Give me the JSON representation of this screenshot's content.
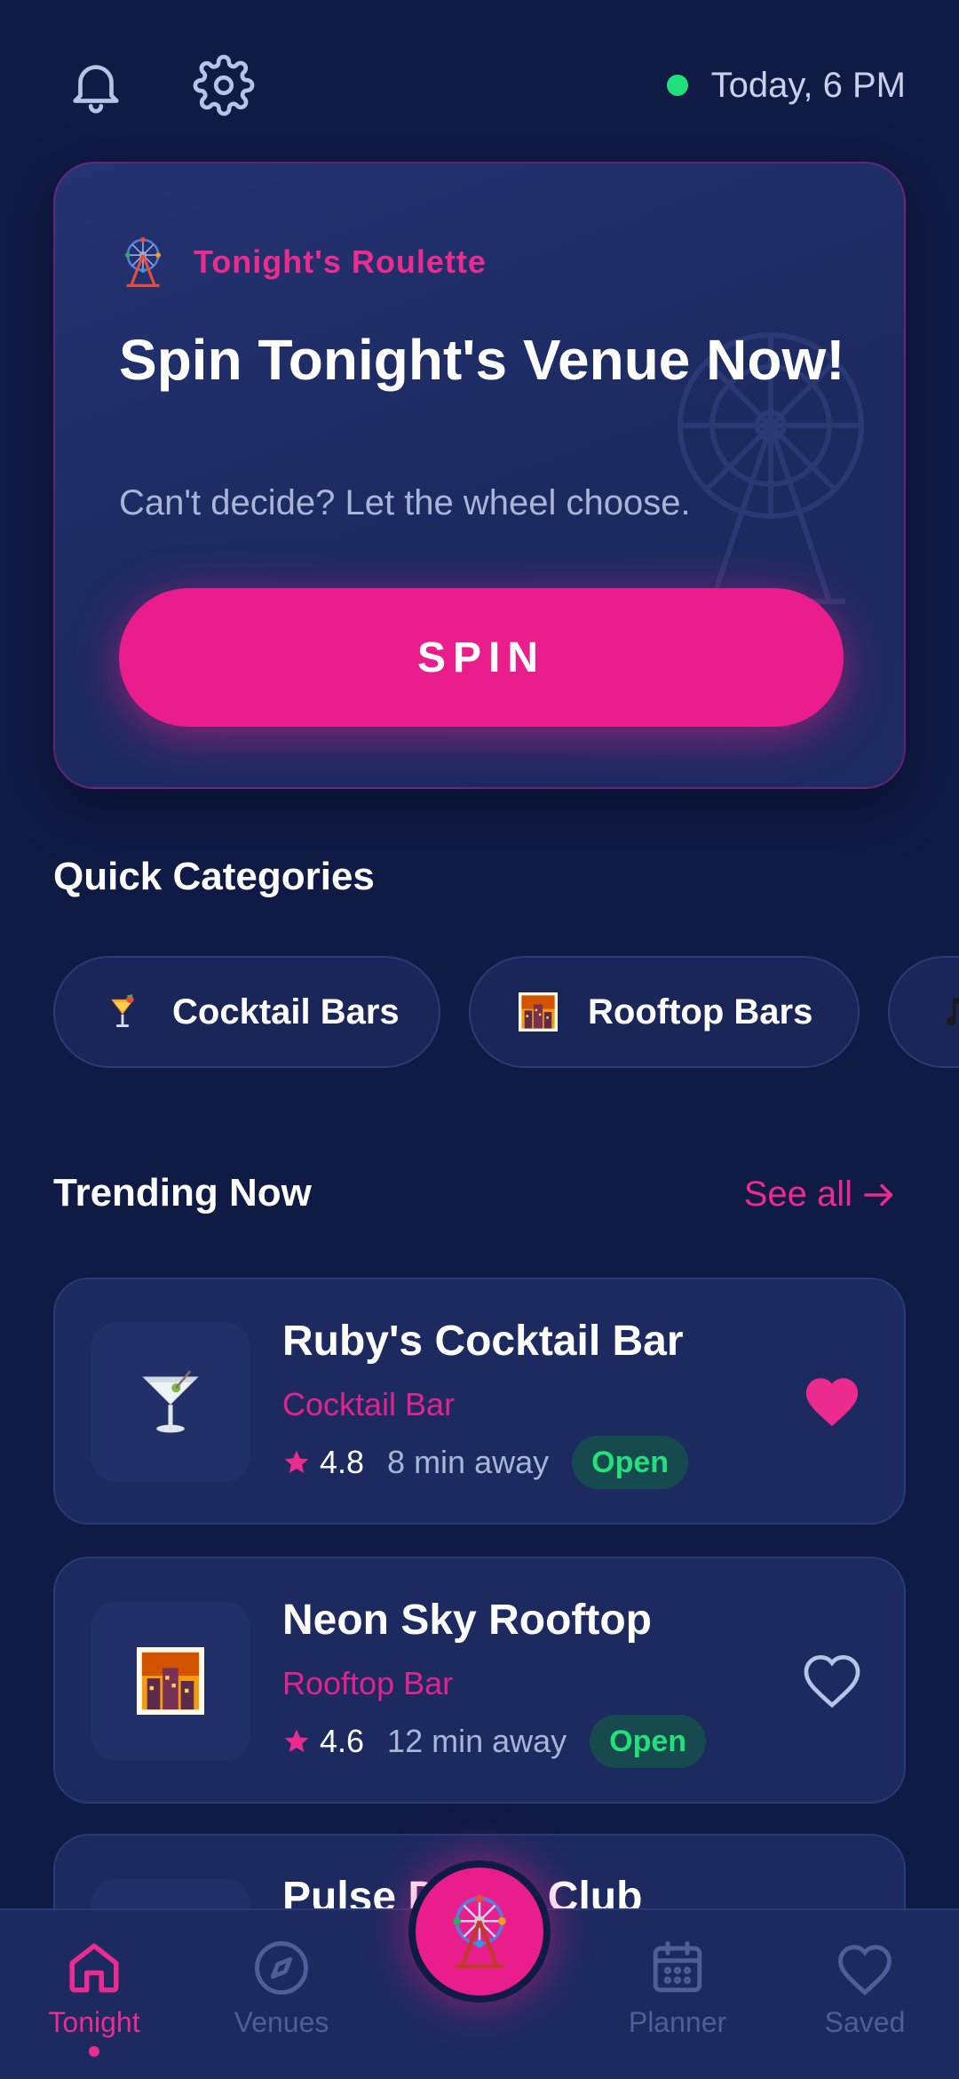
{
  "status": {
    "time_text": "Today, 6 PM",
    "dot_color": "#1fe07a"
  },
  "hero": {
    "tag_label": "Tonight's Roulette",
    "tag_icon": "ferris-wheel",
    "title": "Spin Tonight's Venue Now!",
    "subtitle": "Can't decide? Let the wheel choose.",
    "button_label": "SPIN"
  },
  "categories": {
    "title": "Quick Categories",
    "items": [
      {
        "label": "Cocktail Bars",
        "icon": "tropical-drink"
      },
      {
        "label": "Rooftop Bars",
        "icon": "city-dusk"
      },
      {
        "label": "",
        "icon": "music-note"
      }
    ]
  },
  "trending": {
    "title": "Trending Now",
    "see_all_label": "See all",
    "venues": [
      {
        "name": "Ruby's Cocktail Bar",
        "category": "Cocktail Bar",
        "rating": "4.8",
        "distance": "8 min away",
        "status": "Open",
        "icon": "cocktail-glass",
        "saved": true
      },
      {
        "name": "Neon Sky Rooftop",
        "category": "Rooftop Bar",
        "rating": "4.6",
        "distance": "12 min away",
        "status": "Open",
        "icon": "city-dusk",
        "saved": false
      },
      {
        "name": "Pulse Dance Club",
        "category": "",
        "rating": "",
        "distance": "",
        "status": "",
        "icon": "music-note",
        "saved": false
      }
    ]
  },
  "nav": {
    "items": [
      {
        "label": "Tonight",
        "icon": "home",
        "active": true
      },
      {
        "label": "Venues",
        "icon": "compass",
        "active": false
      },
      {
        "label": "Planner",
        "icon": "calendar",
        "active": false
      },
      {
        "label": "Saved",
        "icon": "heart",
        "active": false
      }
    ],
    "center_icon": "ferris-wheel"
  },
  "colors": {
    "background": "#0f1a45",
    "card": "#1c2a60",
    "accent": "#e91e8c",
    "open_green": "#22e07a"
  }
}
